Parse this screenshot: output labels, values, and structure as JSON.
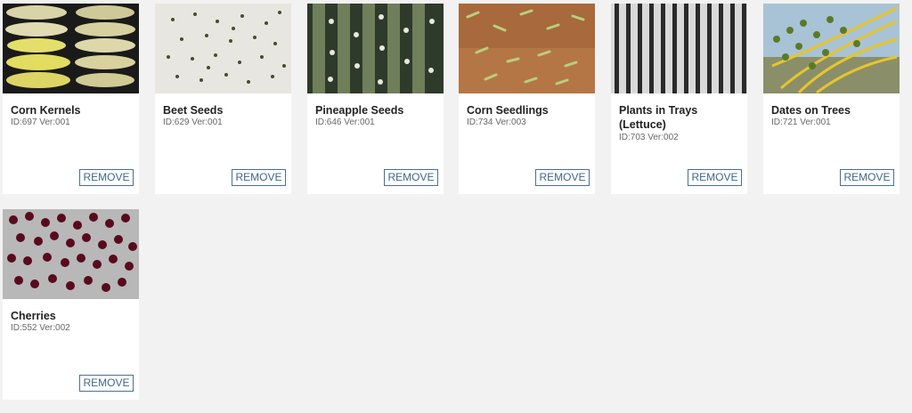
{
  "cards": [
    {
      "title": "Corn Kernels",
      "id_text": "ID:697 Ver:001",
      "remove_label": "REMOVE",
      "image_icon": "corn-kernels-thumbnail"
    },
    {
      "title": "Beet Seeds",
      "id_text": "ID:629 Ver:001",
      "remove_label": "REMOVE",
      "image_icon": "beet-seeds-thumbnail"
    },
    {
      "title": "Pineapple Seeds",
      "id_text": "ID:646 Ver:001",
      "remove_label": "REMOVE",
      "image_icon": "pineapple-seeds-thumbnail"
    },
    {
      "title": "Corn Seedlings",
      "id_text": "ID:734 Ver:003",
      "remove_label": "REMOVE",
      "image_icon": "corn-seedlings-thumbnail"
    },
    {
      "title": "Plants in Trays (Lettuce)",
      "id_text": "ID:703 Ver:002",
      "remove_label": "REMOVE",
      "image_icon": "plants-in-trays-thumbnail"
    },
    {
      "title": "Dates on Trees",
      "id_text": "ID:721 Ver:001",
      "remove_label": "REMOVE",
      "image_icon": "dates-on-trees-thumbnail"
    },
    {
      "title": "Cherries",
      "id_text": "ID:552 Ver:002",
      "remove_label": "REMOVE",
      "image_icon": "cherries-thumbnail"
    }
  ],
  "colors": {
    "background": "#f2f2f2",
    "card": "#ffffff",
    "button_border": "#4a6f96",
    "button_text": "#3f6688"
  }
}
